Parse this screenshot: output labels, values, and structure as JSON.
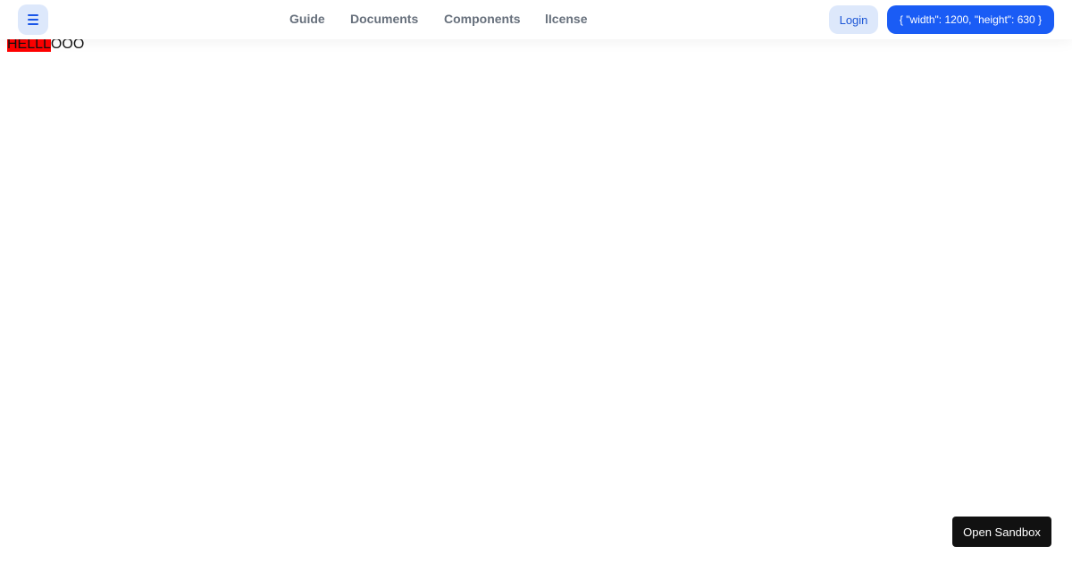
{
  "header": {
    "menu_icon": "hamburger-menu-icon",
    "nav": [
      {
        "label": "Guide"
      },
      {
        "label": "Documents"
      },
      {
        "label": "Components"
      },
      {
        "label": "lIcense"
      }
    ],
    "login_label": "Login",
    "dimensions_label": "{ \"width\": 1200, \"height\": 630 }"
  },
  "main": {
    "hello_highlighted": "HELLL",
    "hello_rest": "OOO"
  },
  "footer": {
    "sandbox_label": "Open Sandbox"
  },
  "colors": {
    "accent": "#1a5cf5",
    "accent_light": "#dde8fb",
    "highlight": "#ff0000",
    "dark_button": "#111111",
    "nav_text": "#67707c"
  }
}
